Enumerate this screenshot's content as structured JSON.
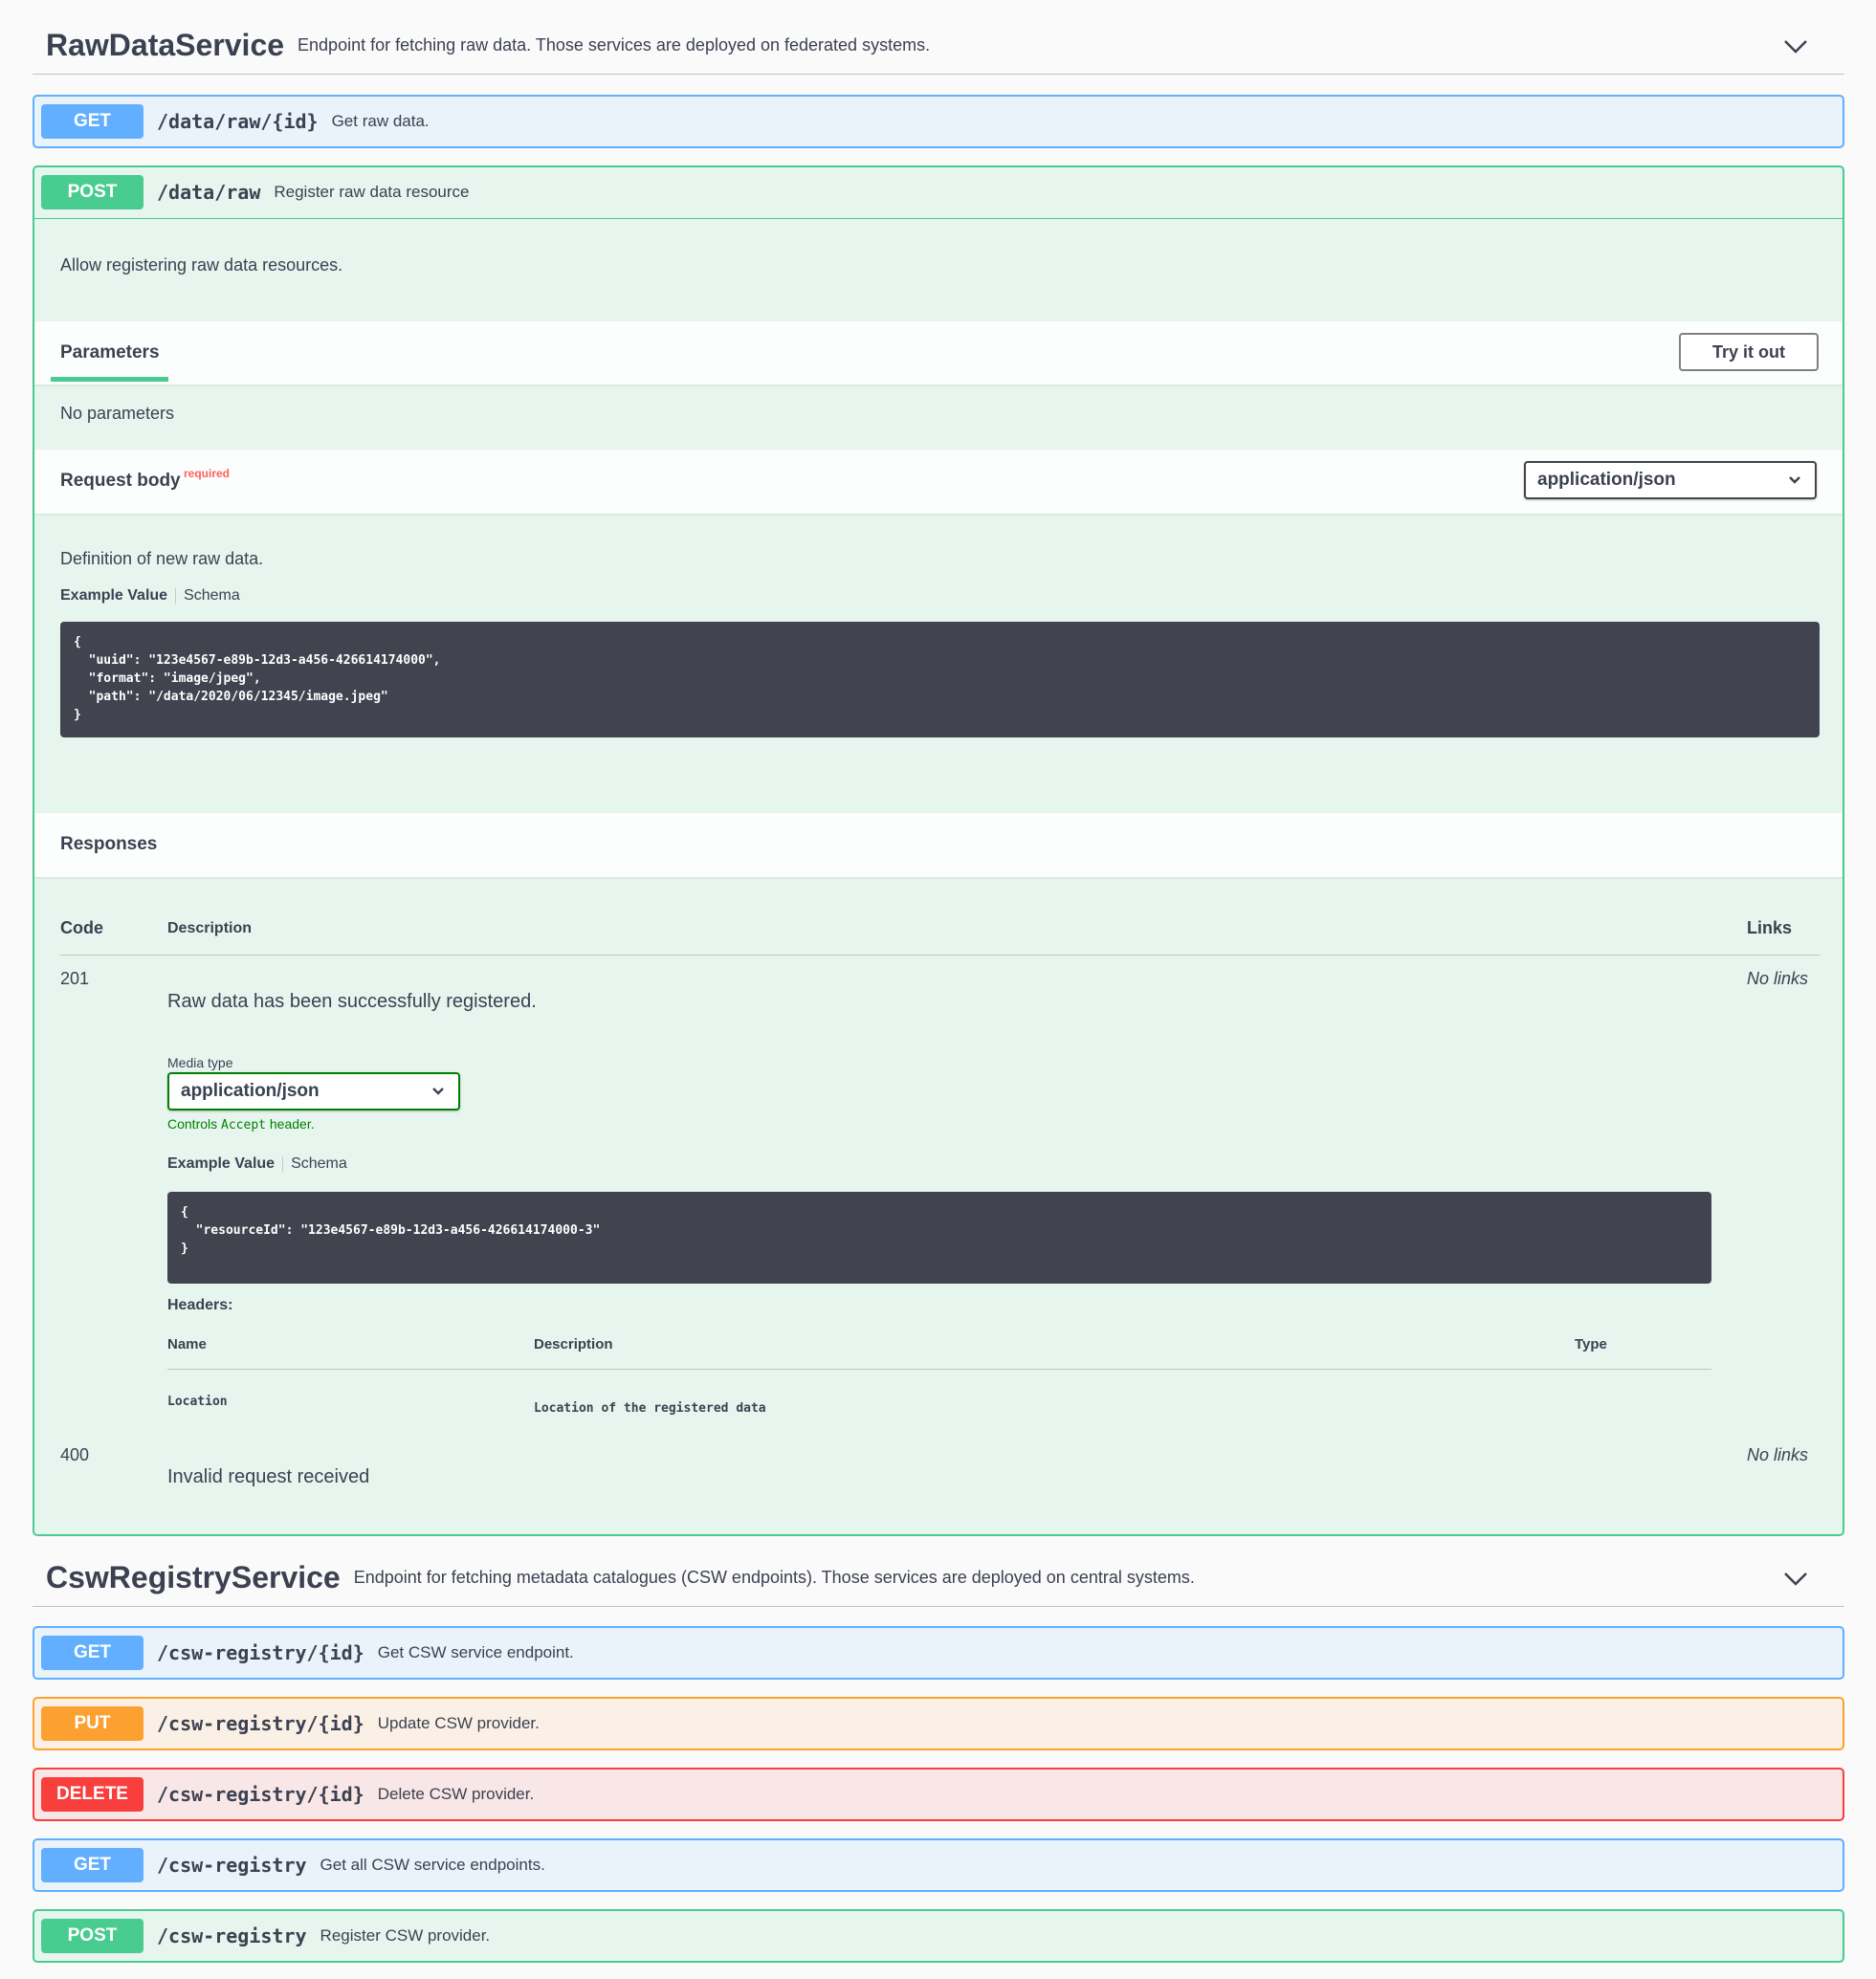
{
  "raw_section": {
    "title": "RawDataService",
    "description": "Endpoint for fetching raw data. Those services are deployed on federated systems."
  },
  "raw_ops": {
    "get_id": {
      "method": "GET",
      "path": "/data/raw/{id}",
      "summary": "Get raw data."
    },
    "post": {
      "method": "POST",
      "path": "/data/raw",
      "summary": "Register raw data resource"
    }
  },
  "post_detail": {
    "description": "Allow registering raw data resources.",
    "params_tab": "Parameters",
    "try_it_out": "Try it out",
    "no_params": "No parameters",
    "request_body_label": "Request body",
    "required_label": "required",
    "content_type": "application/json",
    "body_description": "Definition of new raw data.",
    "example_value_tab": "Example Value",
    "schema_tab": "Schema",
    "example_json": "{\n  \"uuid\": \"123e4567-e89b-12d3-a456-426614174000\",\n  \"format\": \"image/jpeg\",\n  \"path\": \"/data/2020/06/12345/image.jpeg\"\n}",
    "responses_title": "Responses",
    "col_code": "Code",
    "col_description": "Description",
    "col_links": "Links",
    "r201": {
      "code": "201",
      "description": "Raw data has been successfully registered.",
      "links": "No links",
      "media_type_label": "Media type",
      "media_type": "application/json",
      "controls_prefix": "Controls",
      "controls_code": "Accept",
      "controls_suffix": "header.",
      "example_value_tab": "Example Value",
      "schema_tab": "Schema",
      "example_json": "{\n  \"resourceId\": \"123e4567-e89b-12d3-a456-426614174000-3\"\n}",
      "headers_label": "Headers:",
      "h_name": "Name",
      "h_description": "Description",
      "h_type": "Type",
      "header_row": {
        "name": "Location",
        "description": "Location of the registered data"
      }
    },
    "r400": {
      "code": "400",
      "description": "Invalid request received",
      "links": "No links"
    }
  },
  "csw_section": {
    "title": "CswRegistryService",
    "description": "Endpoint for fetching metadata catalogues (CSW endpoints). Those services are deployed on central systems."
  },
  "csw_ops": [
    {
      "method": "GET",
      "path": "/csw-registry/{id}",
      "summary": "Get CSW service endpoint."
    },
    {
      "method": "PUT",
      "path": "/csw-registry/{id}",
      "summary": "Update CSW provider."
    },
    {
      "method": "DELETE",
      "path": "/csw-registry/{id}",
      "summary": "Delete CSW provider."
    },
    {
      "method": "GET",
      "path": "/csw-registry",
      "summary": "Get all CSW service endpoints."
    },
    {
      "method": "POST",
      "path": "/csw-registry",
      "summary": "Register CSW provider."
    }
  ],
  "colors": {
    "get": "#61affe",
    "post": "#49cc90",
    "put": "#fca130",
    "delete": "#f93e3e"
  },
  "icons": {
    "collapse": "chevron-down-icon",
    "select": "chevron-down-icon"
  }
}
